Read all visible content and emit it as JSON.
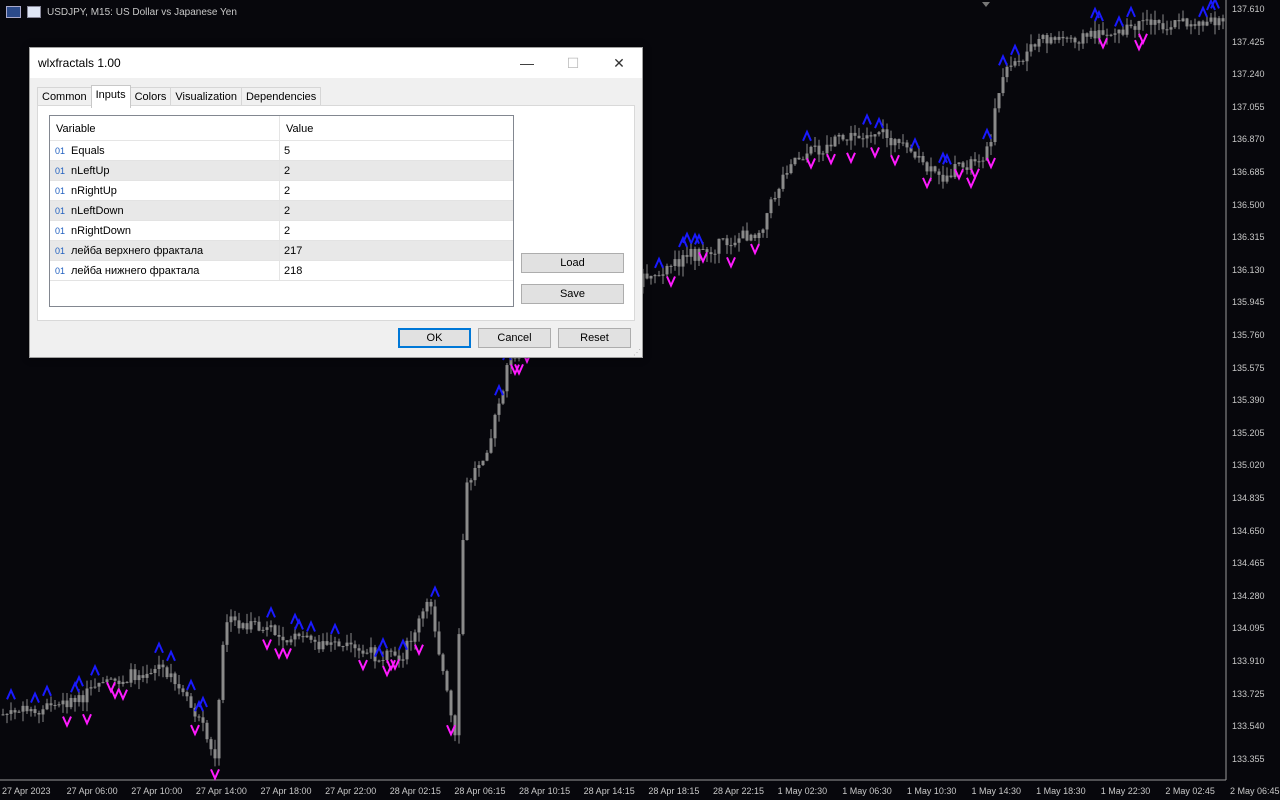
{
  "chart": {
    "symbol_title": "USDJPY, M15:  US Dollar vs Japanese Yen",
    "price_labels": [
      "137.610",
      "137.425",
      "137.240",
      "137.055",
      "136.870",
      "136.685",
      "136.500",
      "136.315",
      "136.130",
      "135.945",
      "135.760",
      "135.575",
      "135.390",
      "135.205",
      "135.020",
      "134.835",
      "134.650",
      "134.465",
      "134.280",
      "134.095",
      "133.910",
      "133.725",
      "133.540",
      "133.355"
    ],
    "time_labels": [
      "27 Apr 2023",
      "27 Apr 06:00",
      "27 Apr 10:00",
      "27 Apr 14:00",
      "27 Apr 18:00",
      "27 Apr 22:00",
      "28 Apr 02:15",
      "28 Apr 06:15",
      "28 Apr 10:15",
      "28 Apr 14:15",
      "28 Apr 18:15",
      "28 Apr 22:15",
      "1 May 02:30",
      "1 May 06:30",
      "1 May 10:30",
      "1 May 14:30",
      "1 May 18:30",
      "1 May 22:30",
      "2 May 02:45",
      "2 May 06:45"
    ],
    "colors": {
      "background": "#07070c",
      "candle": "#8a8a8a",
      "fractal_up": "#1a1aff",
      "fractal_down": "#ff1aff"
    }
  },
  "dialog": {
    "title": "wlxfractals 1.00",
    "tabs": [
      "Common",
      "Inputs",
      "Colors",
      "Visualization",
      "Dependencies"
    ],
    "active_tab": "Inputs",
    "columns": {
      "variable": "Variable",
      "value": "Value"
    },
    "params": [
      {
        "type": "01",
        "name": "Equals",
        "value": "5"
      },
      {
        "type": "01",
        "name": "nLeftUp",
        "value": "2"
      },
      {
        "type": "01",
        "name": "nRightUp",
        "value": "2"
      },
      {
        "type": "01",
        "name": "nLeftDown",
        "value": "2"
      },
      {
        "type": "01",
        "name": "nRightDown",
        "value": "2"
      },
      {
        "type": "01",
        "name": "лейба верхнего фрактала",
        "value": "217"
      },
      {
        "type": "01",
        "name": "лейба нижнего фрактала",
        "value": "218"
      }
    ],
    "load_label": "Load",
    "save_label": "Save",
    "ok_label": "OK",
    "cancel_label": "Cancel",
    "reset_label": "Reset"
  }
}
